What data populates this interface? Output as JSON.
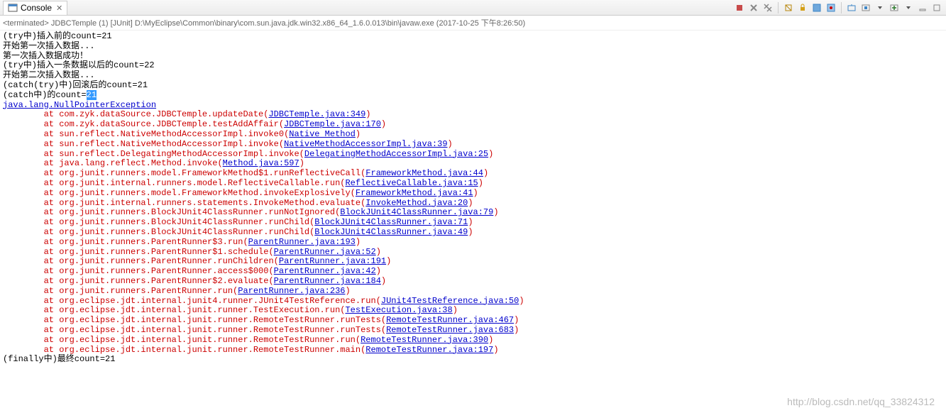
{
  "tab": {
    "icon": "console-icon",
    "title": "Console",
    "close": "✕"
  },
  "status": "<terminated> JDBCTemple (1) [JUnit] D:\\MyEclipse\\Common\\binary\\com.sun.java.jdk.win32.x86_64_1.6.0.013\\bin\\javaw.exe (2017-10-25 下午8:26:50)",
  "lines": [
    {
      "t": "plain",
      "text": "(try中)插入前的count=21"
    },
    {
      "t": "plain",
      "text": "开始第一次插入数据..."
    },
    {
      "t": "plain",
      "text": "第一次插入数据成功！"
    },
    {
      "t": "plain",
      "text": "(try中)插入一条数据以后的count=22"
    },
    {
      "t": "plain",
      "text": "开始第二次插入数据..."
    },
    {
      "t": "plain",
      "text": "(catch(try)中)回滚后的count=21"
    },
    {
      "t": "hl",
      "prefix": "(catch中)的count=",
      "hl": "21"
    },
    {
      "t": "exlink",
      "text": "java.lang.NullPointerException"
    },
    {
      "t": "trace",
      "pre": "at com.zyk.dataSource.JDBCTemple.updateDate(",
      "link": "JDBCTemple.java:349",
      "post": ")"
    },
    {
      "t": "trace",
      "pre": "at com.zyk.dataSource.JDBCTemple.testAddAffair(",
      "link": "JDBCTemple.java:170",
      "post": ")"
    },
    {
      "t": "trace",
      "pre": "at sun.reflect.NativeMethodAccessorImpl.invoke0(",
      "link": "Native Method",
      "post": ")"
    },
    {
      "t": "trace",
      "pre": "at sun.reflect.NativeMethodAccessorImpl.invoke(",
      "link": "NativeMethodAccessorImpl.java:39",
      "post": ")"
    },
    {
      "t": "trace",
      "pre": "at sun.reflect.DelegatingMethodAccessorImpl.invoke(",
      "link": "DelegatingMethodAccessorImpl.java:25",
      "post": ")"
    },
    {
      "t": "trace",
      "pre": "at java.lang.reflect.Method.invoke(",
      "link": "Method.java:597",
      "post": ")"
    },
    {
      "t": "trace",
      "pre": "at org.junit.runners.model.FrameworkMethod$1.runReflectiveCall(",
      "link": "FrameworkMethod.java:44",
      "post": ")"
    },
    {
      "t": "trace",
      "pre": "at org.junit.internal.runners.model.ReflectiveCallable.run(",
      "link": "ReflectiveCallable.java:15",
      "post": ")"
    },
    {
      "t": "trace",
      "pre": "at org.junit.runners.model.FrameworkMethod.invokeExplosively(",
      "link": "FrameworkMethod.java:41",
      "post": ")"
    },
    {
      "t": "trace",
      "pre": "at org.junit.internal.runners.statements.InvokeMethod.evaluate(",
      "link": "InvokeMethod.java:20",
      "post": ")"
    },
    {
      "t": "trace",
      "pre": "at org.junit.runners.BlockJUnit4ClassRunner.runNotIgnored(",
      "link": "BlockJUnit4ClassRunner.java:79",
      "post": ")"
    },
    {
      "t": "trace",
      "pre": "at org.junit.runners.BlockJUnit4ClassRunner.runChild(",
      "link": "BlockJUnit4ClassRunner.java:71",
      "post": ")"
    },
    {
      "t": "trace",
      "pre": "at org.junit.runners.BlockJUnit4ClassRunner.runChild(",
      "link": "BlockJUnit4ClassRunner.java:49",
      "post": ")"
    },
    {
      "t": "trace",
      "pre": "at org.junit.runners.ParentRunner$3.run(",
      "link": "ParentRunner.java:193",
      "post": ")"
    },
    {
      "t": "trace",
      "pre": "at org.junit.runners.ParentRunner$1.schedule(",
      "link": "ParentRunner.java:52",
      "post": ")"
    },
    {
      "t": "trace",
      "pre": "at org.junit.runners.ParentRunner.runChildren(",
      "link": "ParentRunner.java:191",
      "post": ")"
    },
    {
      "t": "trace",
      "pre": "at org.junit.runners.ParentRunner.access$000(",
      "link": "ParentRunner.java:42",
      "post": ")"
    },
    {
      "t": "trace",
      "pre": "at org.junit.runners.ParentRunner$2.evaluate(",
      "link": "ParentRunner.java:184",
      "post": ")"
    },
    {
      "t": "trace",
      "pre": "at org.junit.runners.ParentRunner.run(",
      "link": "ParentRunner.java:236",
      "post": ")"
    },
    {
      "t": "trace",
      "pre": "at org.eclipse.jdt.internal.junit4.runner.JUnit4TestReference.run(",
      "link": "JUnit4TestReference.java:50",
      "post": ")"
    },
    {
      "t": "trace",
      "pre": "at org.eclipse.jdt.internal.junit.runner.TestExecution.run(",
      "link": "TestExecution.java:38",
      "post": ")"
    },
    {
      "t": "trace",
      "pre": "at org.eclipse.jdt.internal.junit.runner.RemoteTestRunner.runTests(",
      "link": "RemoteTestRunner.java:467",
      "post": ")"
    },
    {
      "t": "trace",
      "pre": "at org.eclipse.jdt.internal.junit.runner.RemoteTestRunner.runTests(",
      "link": "RemoteTestRunner.java:683",
      "post": ")"
    },
    {
      "t": "trace",
      "pre": "at org.eclipse.jdt.internal.junit.runner.RemoteTestRunner.run(",
      "link": "RemoteTestRunner.java:390",
      "post": ")"
    },
    {
      "t": "trace",
      "pre": "at org.eclipse.jdt.internal.junit.runner.RemoteTestRunner.main(",
      "link": "RemoteTestRunner.java:197",
      "post": ")"
    },
    {
      "t": "plain",
      "text": "(finally中)最终count=21"
    }
  ],
  "watermark": "http://blog.csdn.net/qq_33824312",
  "toolbar_icons": {
    "terminate": "terminate-icon",
    "remove_all": "remove-all-icon",
    "remove_launch": "remove-launch-icon",
    "clear": "clear-icon",
    "scroll_lock": "scroll-lock-icon",
    "word_wrap": "word-wrap-icon",
    "pin": "pin-icon",
    "display": "display-icon",
    "open": "open-icon",
    "dropdown": "dropdown-icon",
    "min": "min-icon",
    "max": "max-icon"
  }
}
